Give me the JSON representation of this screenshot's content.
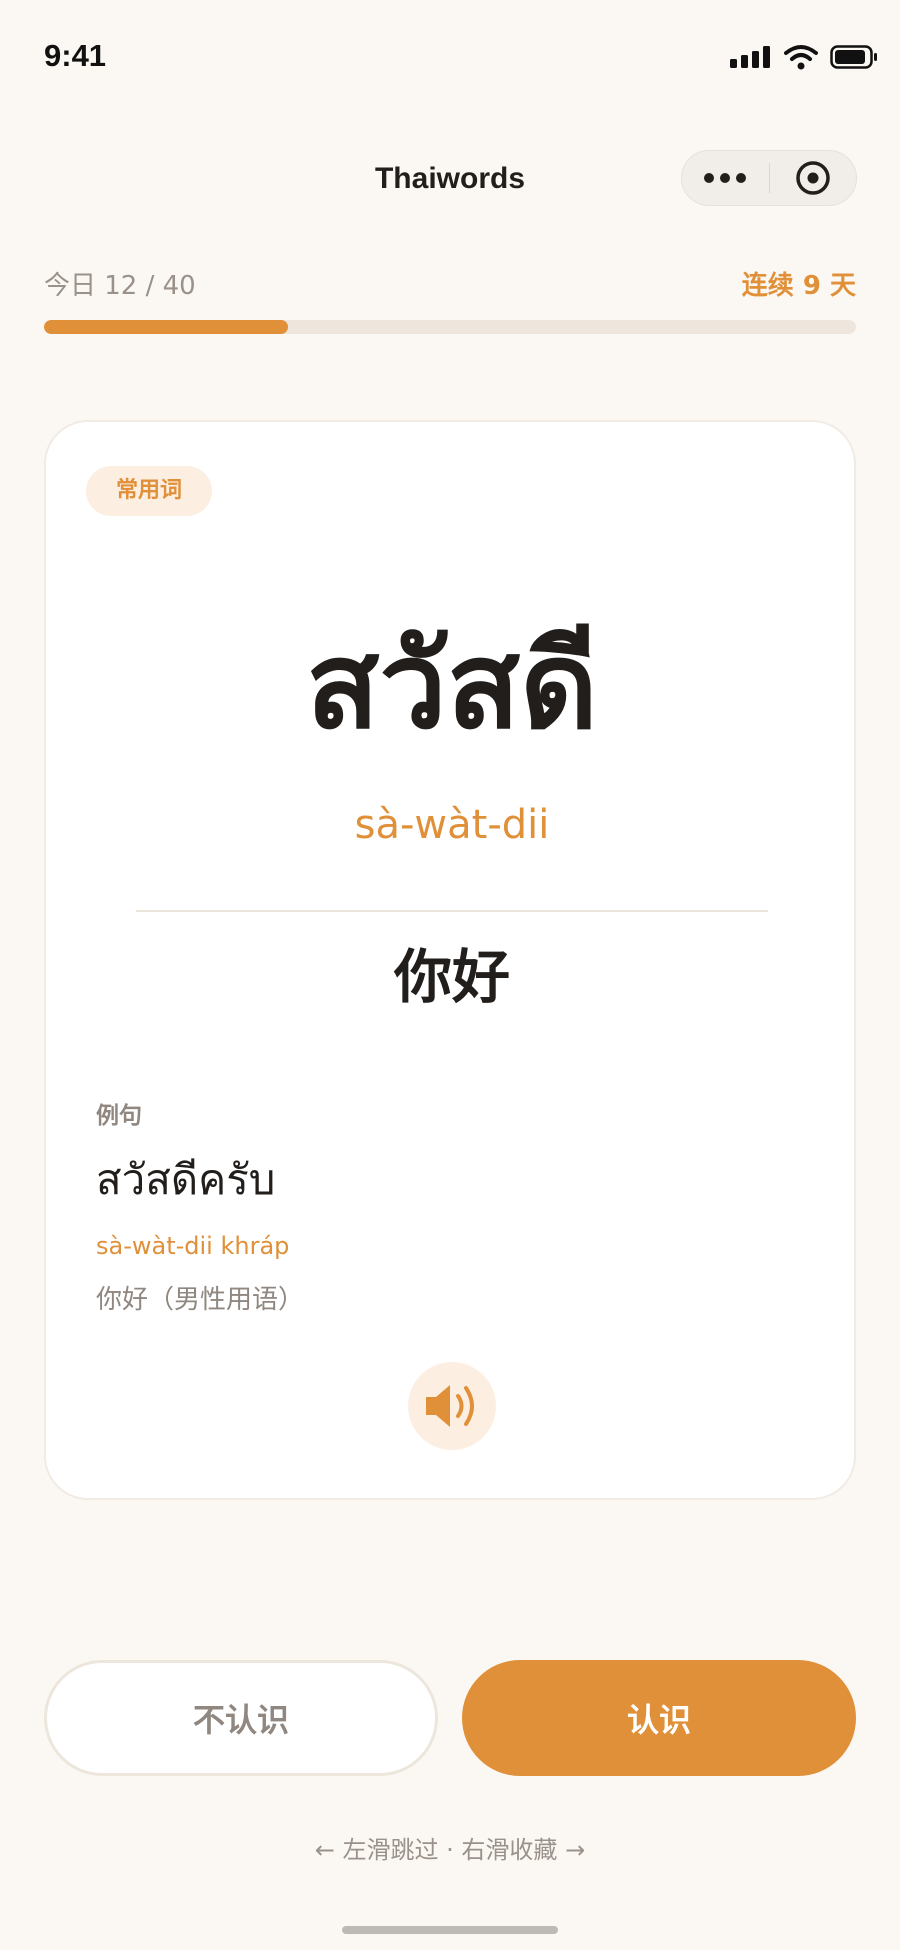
{
  "status_bar": {
    "time": "9:41"
  },
  "nav": {
    "title": "Thaiwords"
  },
  "progress": {
    "label": "今日 12 / 40",
    "done": 12,
    "total": 40,
    "streak": "连续 9 天"
  },
  "card": {
    "tag": "常用词",
    "word": "สวัสดี",
    "romanization": "sà-wàt-dii",
    "meaning": "你好",
    "example": {
      "label": "例句",
      "thai": "สวัสดีครับ",
      "romanization": "sà-wàt-dii khráp",
      "meaning": "你好（男性用语）"
    },
    "audio_icon": "speaker-icon"
  },
  "actions": {
    "unknown_label": "不认识",
    "known_label": "认识"
  },
  "hint": "← 左滑跳过 · 右滑收藏 →",
  "colors": {
    "accent": "#E09038",
    "background": "#FBF8F3",
    "card": "#FFFFFF",
    "text": "#221E1B",
    "muted": "#8F8780"
  }
}
